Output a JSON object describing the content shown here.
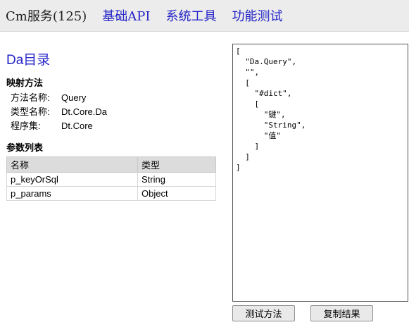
{
  "header": {
    "service_label": "Cm服务(125)",
    "nav": [
      {
        "label": "基础API"
      },
      {
        "label": "系统工具"
      },
      {
        "label": "功能测试"
      }
    ]
  },
  "page": {
    "title": "Da目录"
  },
  "mapping": {
    "title": "映射方法",
    "method_key": "方法名称:",
    "method_value": "Query",
    "type_key": "类型名称:",
    "type_value": "Dt.Core.Da",
    "assembly_key": "程序集:",
    "assembly_value": "Dt.Core"
  },
  "params": {
    "title": "参数列表",
    "headers": [
      "名称",
      "类型"
    ],
    "rows": [
      [
        "p_keyOrSql",
        "String"
      ],
      [
        "p_params",
        "Object"
      ]
    ]
  },
  "result": {
    "text": "[\n  \"Da.Query\",\n  \"\",\n  [\n    \"#dict\",\n    [\n      \"键\",\n      \"String\",\n      \"值\"\n    ]\n  ]\n]"
  },
  "buttons": {
    "test_label": "测试方法",
    "copy_label": "复制结果"
  }
}
